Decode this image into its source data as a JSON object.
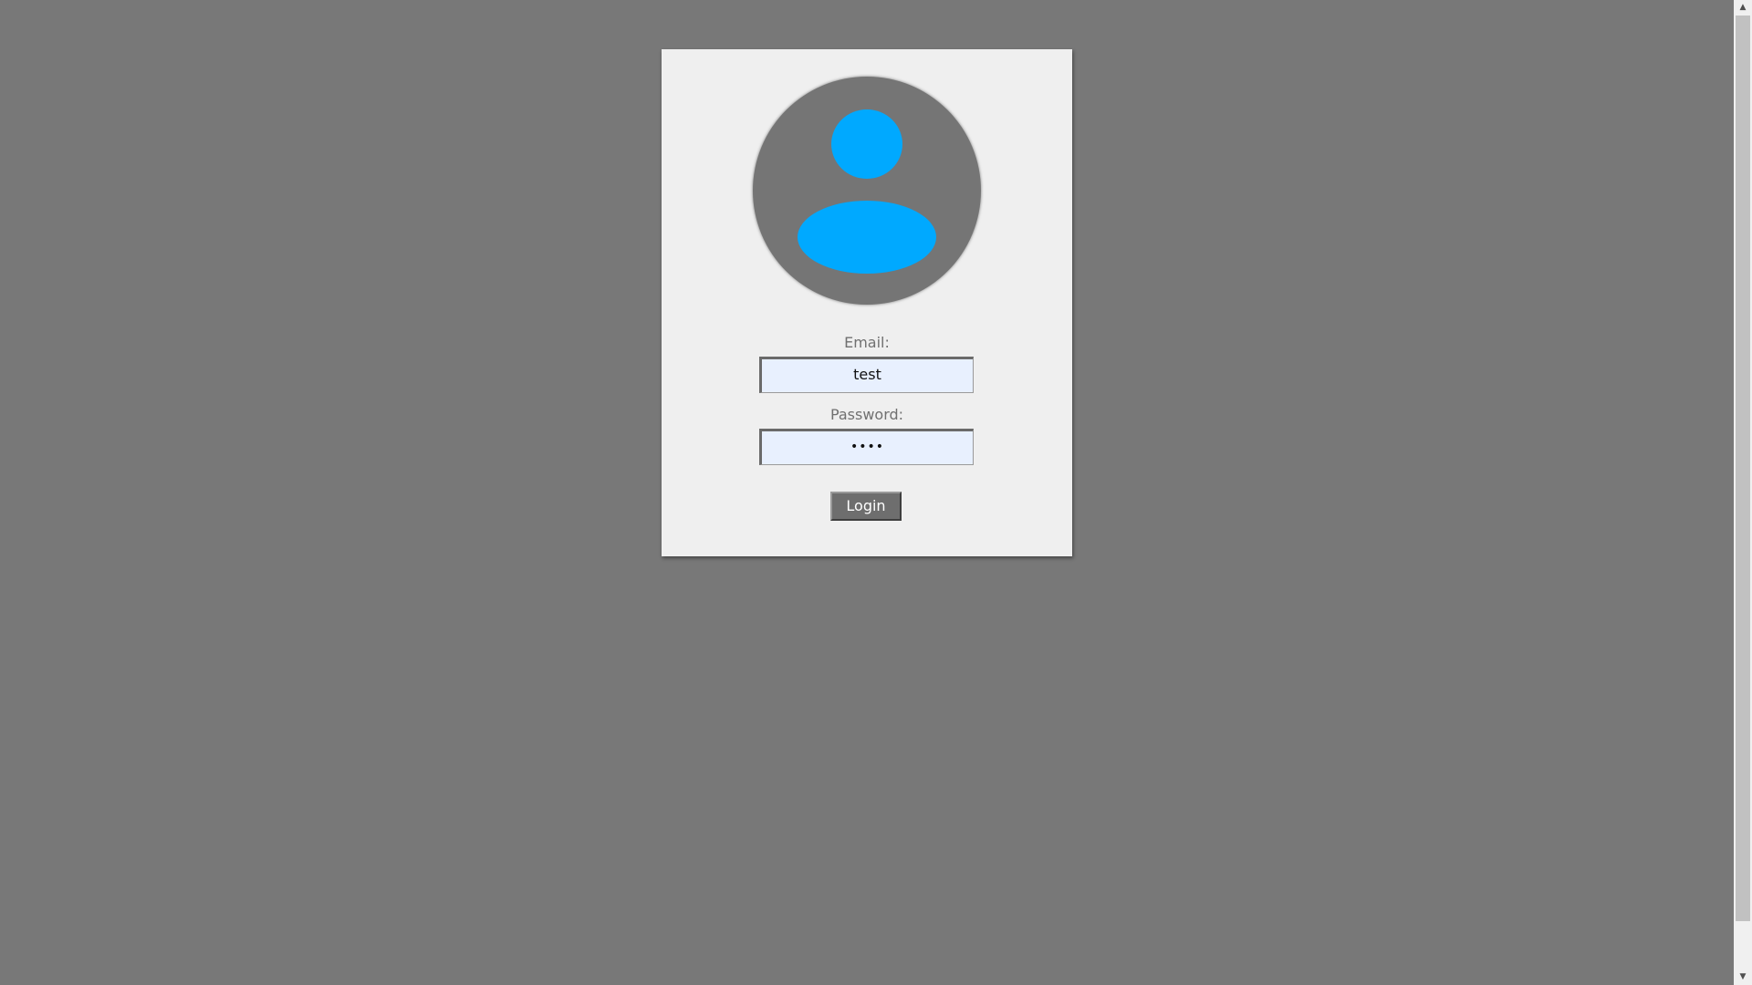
{
  "login_form": {
    "email_label": "Email:",
    "email_value": "test",
    "password_label": "Password:",
    "password_value": "••••",
    "login_button_label": "Login"
  },
  "avatar": {
    "icon": "user-avatar-icon",
    "background_color": "#757575",
    "figure_color": "#00a9ff"
  },
  "scrollbar": {
    "up_arrow": "▲",
    "down_arrow": "▼"
  },
  "colors": {
    "page_background": "#787878",
    "card_background": "#efefef",
    "input_background": "#e8f0fe",
    "button_background": "#6e6e6e"
  }
}
